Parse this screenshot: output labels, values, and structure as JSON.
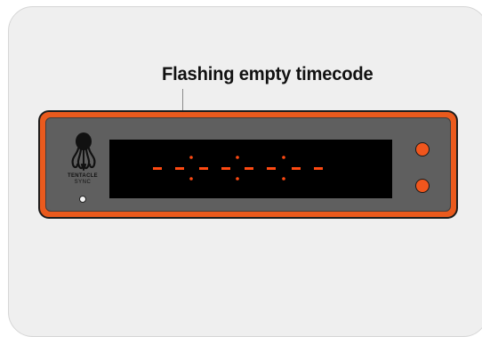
{
  "heading": "Flashing empty timecode",
  "device": {
    "brand_line1": "TENTACLE",
    "brand_line2": "SYNC",
    "display_digits": [
      "-",
      "-",
      "-",
      "-",
      "-",
      "-",
      "-",
      "-"
    ],
    "display_state": "flashing"
  },
  "colors": {
    "accent": "#ea5a1d",
    "display_segment": "#ff4a12",
    "display_background": "#000000",
    "panel": "#5f5f5f",
    "card_background": "#efefef"
  },
  "icons": {
    "logo": "octopus-icon"
  }
}
